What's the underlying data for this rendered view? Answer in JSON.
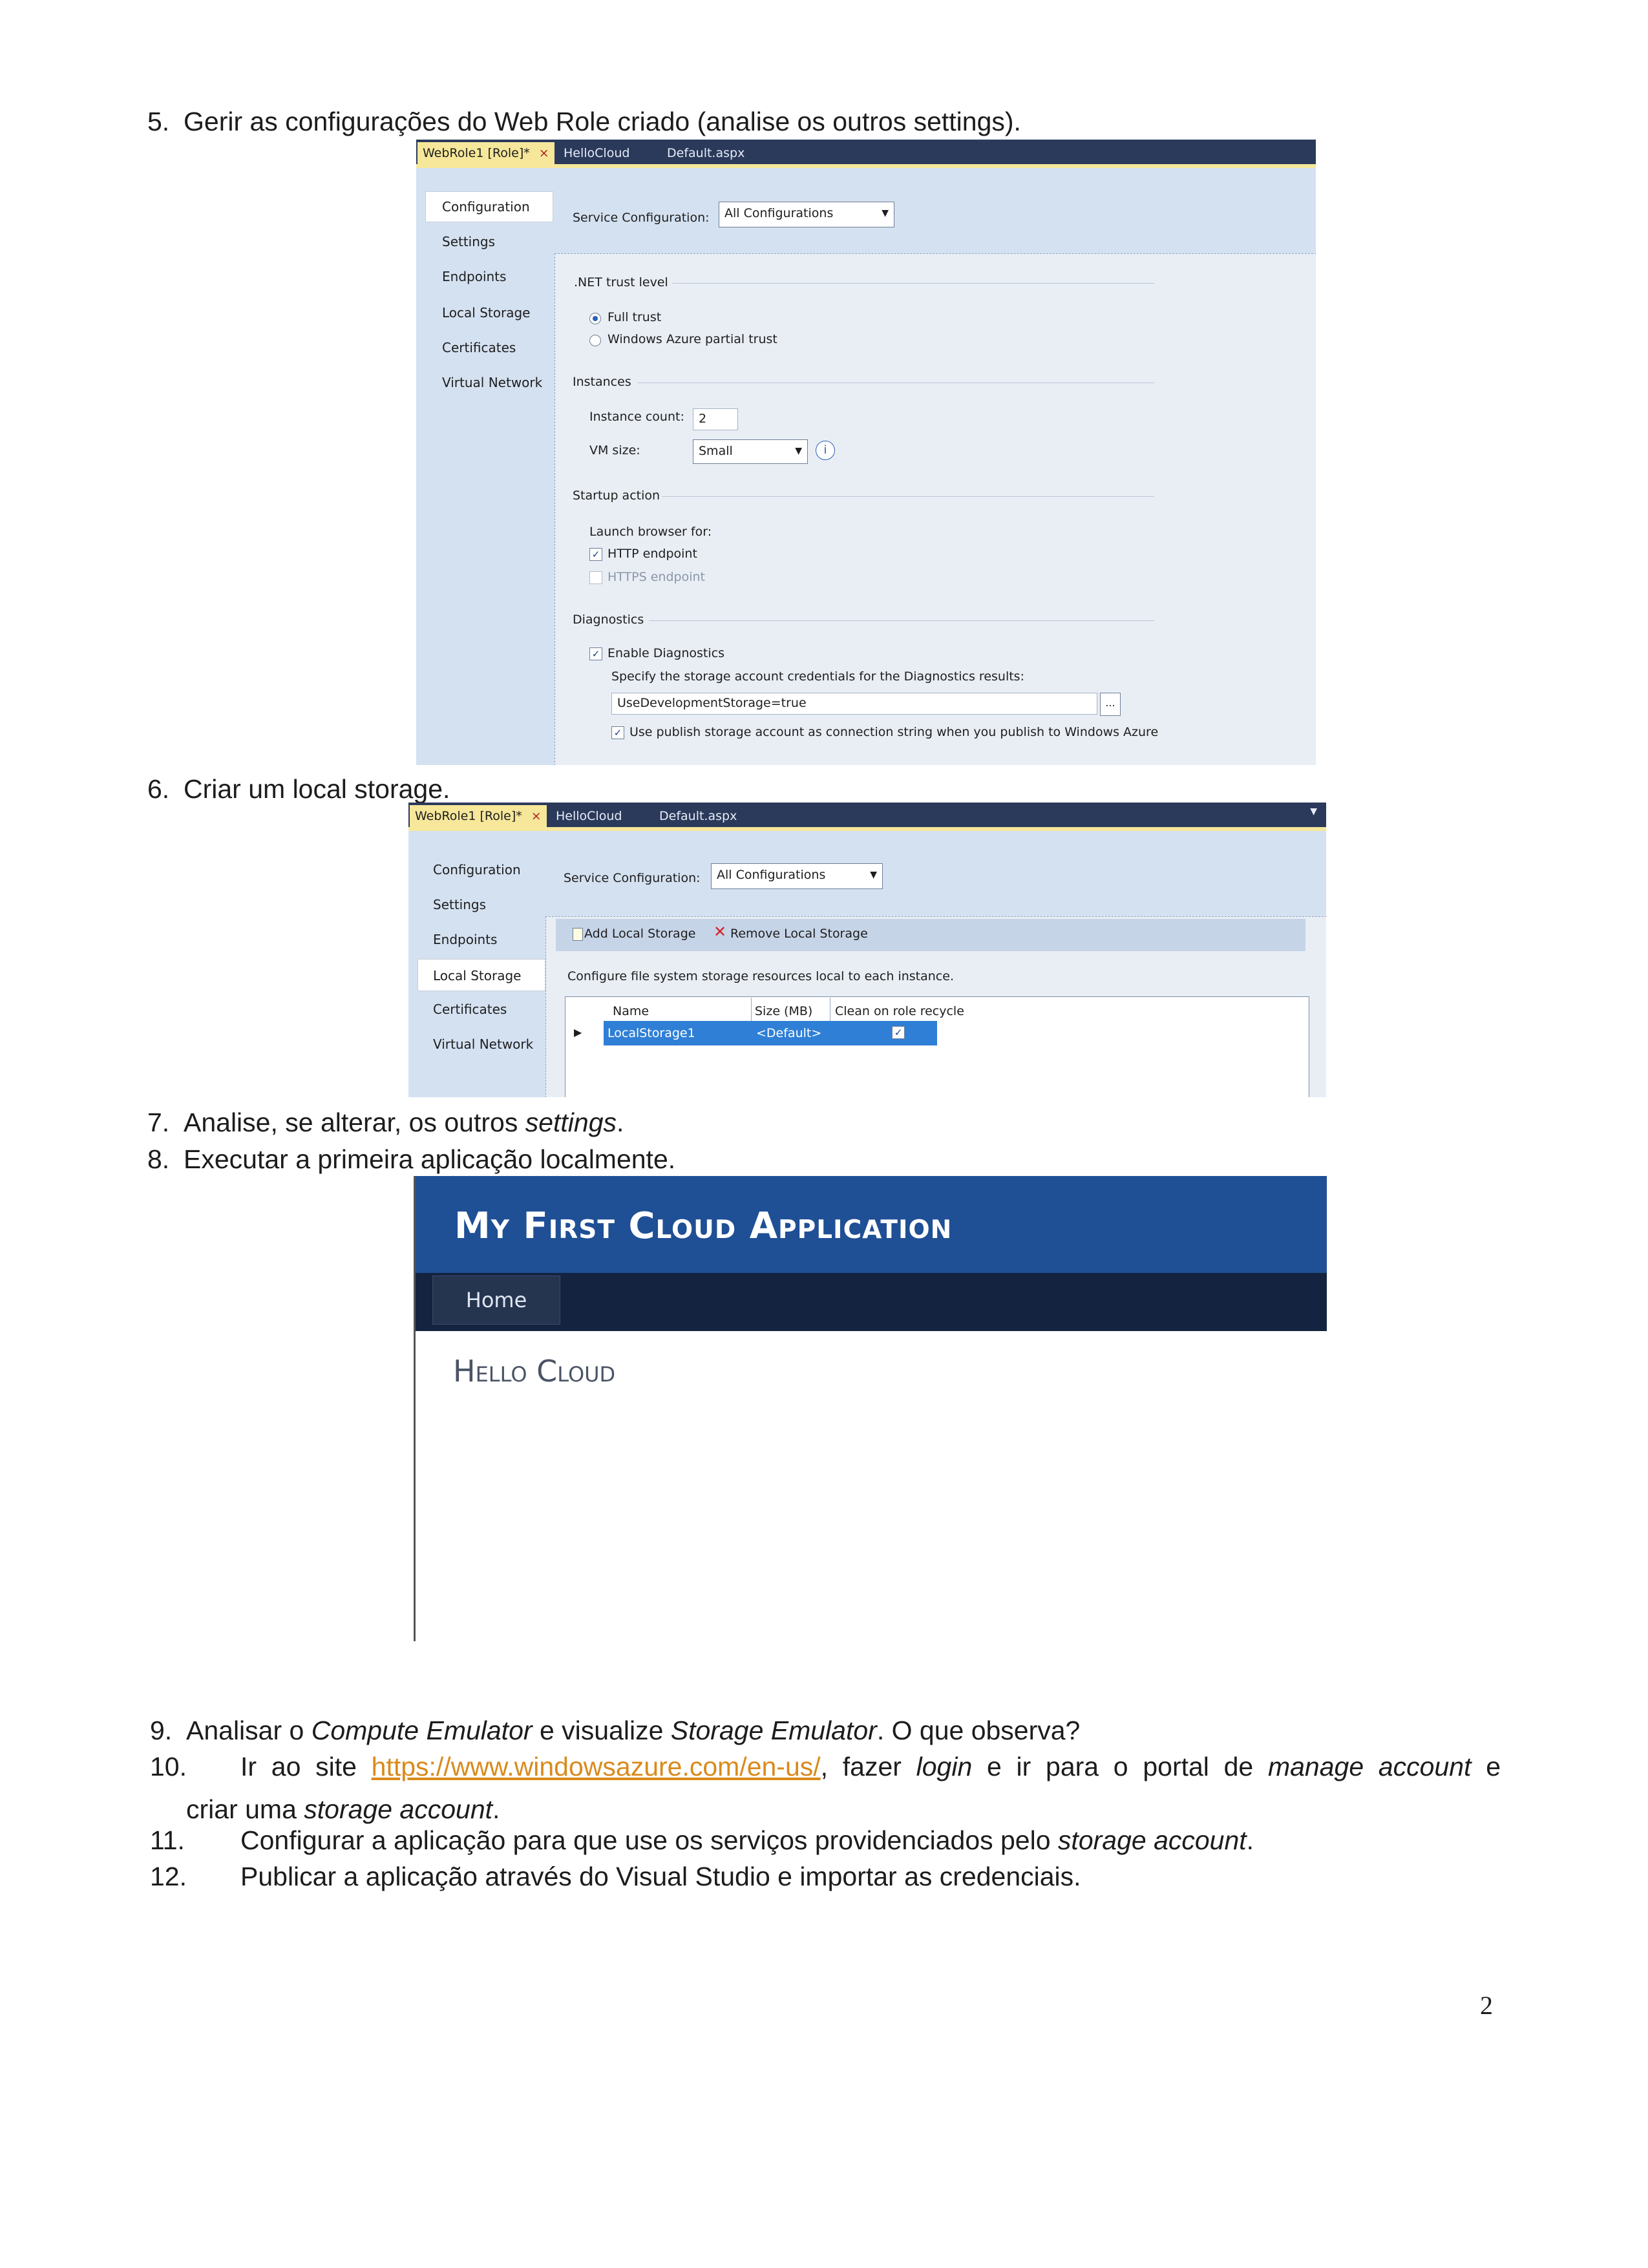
{
  "steps": {
    "s5": {
      "num": "5.",
      "text": "Gerir as configurações do Web Role criado (analise os outros settings)."
    },
    "s6": {
      "num": "6.",
      "text": "Criar um local storage."
    },
    "s7": {
      "num": "7.",
      "text_a": "Analise, se alterar, os outros ",
      "text_em": "settings",
      "text_b": "."
    },
    "s8": {
      "num": "8.",
      "text": "Executar a primeira aplicação localmente."
    },
    "s9": {
      "num": "9.",
      "a": "Analisar o ",
      "em1": "Compute Emulator",
      "b": " e visualize ",
      "em2": "Storage Emulator",
      "c": ". O que observa?"
    },
    "s10": {
      "num": "10.",
      "a": "Ir ao site ",
      "link": "https://www.windowsazure.com/en-us/",
      "b": ", fazer ",
      "em1": "login",
      "c": " e ir para o portal de ",
      "em2": "manage account",
      "d": " e",
      "line2_a": "criar uma ",
      "line2_em": "storage account",
      "line2_b": "."
    },
    "s11": {
      "num": "11.",
      "a": "Configurar a aplicação para que use os serviços providenciados pelo ",
      "em": "storage account",
      "b": "."
    },
    "s12": {
      "num": "12.",
      "text": "Publicar a aplicação através do Visual Studio e importar as credenciais."
    }
  },
  "page_number": "2",
  "shot1": {
    "tabs": [
      "WebRole1 [Role]*",
      "HelloCloud",
      "Default.aspx"
    ],
    "tab_close": "×",
    "nav": [
      "Configuration",
      "Settings",
      "Endpoints",
      "Local Storage",
      "Certificates",
      "Virtual Network"
    ],
    "service_config_label": "Service Configuration:",
    "service_config_value": "All Configurations",
    "net_trust_header": ".NET trust level",
    "full_trust": "Full trust",
    "partial_trust": "Windows Azure partial trust",
    "instances_header": "Instances",
    "instance_count_label": "Instance count:",
    "instance_count_value": "2",
    "vm_size_label": "VM size:",
    "vm_size_value": "Small",
    "startup_header": "Startup action",
    "launch_label": "Launch browser for:",
    "http_endpoint": "HTTP endpoint",
    "https_endpoint": "HTTPS endpoint",
    "diagnostics_header": "Diagnostics",
    "enable_diag": "Enable Diagnostics",
    "specify_label": "Specify the storage account credentials for the Diagnostics results:",
    "conn_value": "UseDevelopmentStorage=true",
    "browse_btn": "...",
    "use_publish": "Use publish storage account as connection string when you publish to Windows Azure"
  },
  "shot2": {
    "tabs": [
      "WebRole1 [Role]*",
      "HelloCloud",
      "Default.aspx"
    ],
    "tab_close": "×",
    "nav": [
      "Configuration",
      "Settings",
      "Endpoints",
      "Local Storage",
      "Certificates",
      "Virtual Network"
    ],
    "service_config_label": "Service Configuration:",
    "service_config_value": "All Configurations",
    "add_btn": "Add Local Storage",
    "remove_btn": "Remove Local Storage",
    "description": "Configure file system storage resources local to each instance.",
    "columns": [
      "Name",
      "Size (MB)",
      "Clean on role recycle"
    ],
    "row": {
      "name": "LocalStorage1",
      "size": "<Default>"
    }
  },
  "app": {
    "title": "My First Cloud Application",
    "menu_home": "Home",
    "heading": "Hello Cloud"
  }
}
